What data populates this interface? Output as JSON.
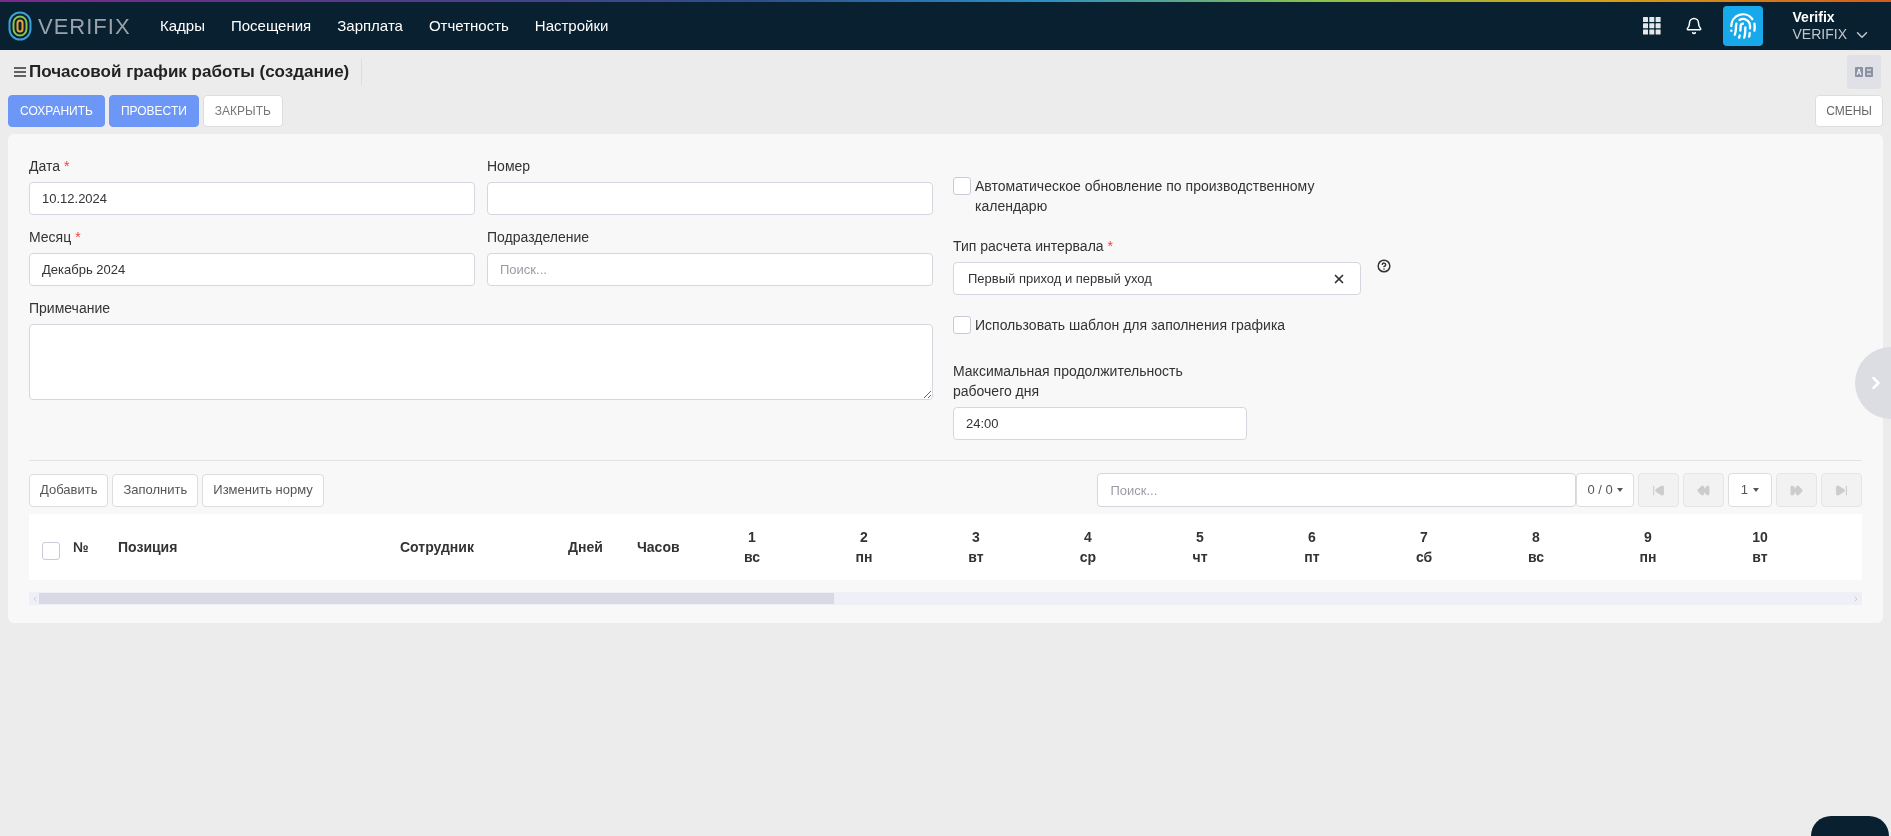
{
  "topbar": {
    "logo": "VERIFIX",
    "menu": [
      {
        "label": "Кадры"
      },
      {
        "label": "Посещения"
      },
      {
        "label": "Зарплата"
      },
      {
        "label": "Отчетность"
      },
      {
        "label": "Настройки"
      }
    ],
    "user": {
      "name": "Verifix",
      "company": "VERIFIX"
    }
  },
  "page": {
    "title": "Почасовой график работы (создание)"
  },
  "actions": [
    {
      "label": "СОХРАНИТЬ",
      "kind": "primary"
    },
    {
      "label": "ПРОВЕСТИ",
      "kind": "primary"
    },
    {
      "label": "ЗАКРЫТЬ",
      "kind": "default"
    }
  ],
  "side_action": {
    "label": "СМЕНЫ"
  },
  "form": {
    "left": [
      {
        "kind": "input",
        "label": "Дата",
        "required_mark": "*",
        "value": "10.12.2024"
      },
      {
        "kind": "input",
        "label": "Номер"
      },
      {
        "kind": "input",
        "label": "Месяц",
        "required_mark": "*",
        "value": "Декабрь 2024"
      },
      {
        "kind": "input",
        "label": "Подразделение",
        "placeholder": "Поиск..."
      },
      {
        "kind": "textarea",
        "label": "Примечание"
      }
    ],
    "right": [
      {
        "kind": "checkbox",
        "label": "Автоматическое обновление по производственному календарю",
        "checked": false
      },
      {
        "kind": "select",
        "label": "Тип расчета интервала",
        "required_mark": "*",
        "value": "Первый приход и первый уход",
        "clearable": true,
        "help": true
      },
      {
        "kind": "checkbox",
        "label": "Использовать шаблон для заполнения графика",
        "checked": false
      },
      {
        "kind": "input",
        "label": "Максимальная продолжительность рабочего дня",
        "value": "24:00"
      }
    ]
  },
  "table": {
    "tools": [
      {
        "label": "Добавить"
      },
      {
        "label": "Заполнить"
      },
      {
        "label": "Изменить норму"
      }
    ],
    "search": {
      "placeholder": "Поиск..."
    },
    "count": "0 / 0",
    "page": "1",
    "select_all": {
      "checked": false
    },
    "columns": [
      {
        "label": "№"
      },
      {
        "label": "Позиция"
      },
      {
        "label": "Сотрудник"
      },
      {
        "label": "Дней"
      },
      {
        "label": "Часов"
      }
    ],
    "days": [
      {
        "day": "1",
        "weekday": "вс"
      },
      {
        "day": "2",
        "weekday": "пн"
      },
      {
        "day": "3",
        "weekday": "вт"
      },
      {
        "day": "4",
        "weekday": "ср"
      },
      {
        "day": "5",
        "weekday": "чт"
      },
      {
        "day": "6",
        "weekday": "пт"
      },
      {
        "day": "7",
        "weekday": "сб"
      },
      {
        "day": "8",
        "weekday": "вс"
      },
      {
        "day": "9",
        "weekday": "пн"
      },
      {
        "day": "10",
        "weekday": "вт"
      }
    ]
  }
}
